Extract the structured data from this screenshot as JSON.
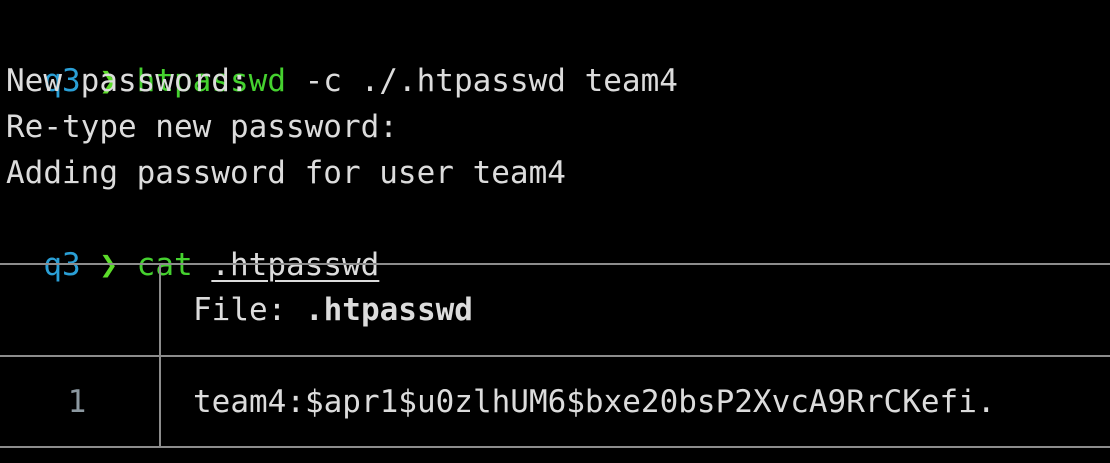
{
  "terminal": {
    "line1": {
      "host": "q3",
      "arrow": "❯",
      "command": "htpasswd",
      "args": " -c ./.htpasswd team4"
    },
    "line2": {
      "text": "New password:"
    },
    "line3": {
      "text": "Re-type new password:"
    },
    "line4": {
      "text": "Adding password for user team4"
    },
    "line5": {
      "host": "q3",
      "arrow": "❯",
      "command": "cat",
      "path": ".htpasswd"
    }
  },
  "file_view": {
    "header_label": "File: ",
    "file_name": ".htpasswd",
    "rows": [
      {
        "number": "1",
        "content": "team4:$apr1$u0zlhUM6$bxe20bsP2XvcA9RrCKefi."
      }
    ]
  },
  "colors": {
    "background": "#000000",
    "prompt_host": "#2a9fd6",
    "prompt_arrow": "#5cdc2a",
    "command": "#45d12f",
    "text": "#dcdcdc",
    "border": "#8c8c8c",
    "line_number": "#8c98a0"
  }
}
